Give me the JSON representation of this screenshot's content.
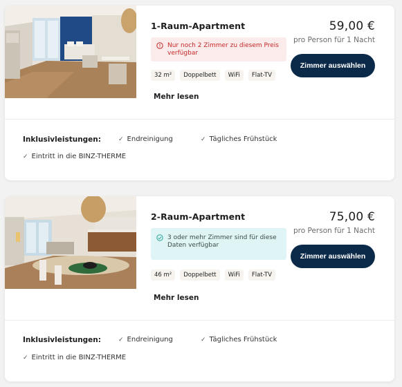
{
  "rooms": [
    {
      "title": "1-Raum-Apartment",
      "notice": "Nur noch 2 Zimmer zu diesem Preis verfügbar",
      "notice_type": "warning",
      "features": [
        "32 m²",
        "Doppelbett",
        "WiFi",
        "Flat-TV"
      ],
      "more_label": "Mehr lesen",
      "price": "59,00 €",
      "price_note": "pro Person für 1 Nacht",
      "select_label": "Zimmer auswählen",
      "inclusions_label": "Inklusivleistungen:",
      "inclusions": [
        "Endreinigung",
        "Tägliches Frühstück",
        "Eintritt in die BINZ-THERME"
      ]
    },
    {
      "title": "2-Raum-Apartment",
      "notice": "3 oder mehr Zimmer sind für diese Daten verfügbar",
      "notice_type": "availability",
      "features": [
        "46 m²",
        "Doppelbett",
        "WiFi",
        "Flat-TV"
      ],
      "more_label": "Mehr lesen",
      "price": "75,00 €",
      "price_note": "pro Person für 1 Nacht",
      "select_label": "Zimmer auswählen",
      "inclusions_label": "Inklusivleistungen:",
      "inclusions": [
        "Endreinigung",
        "Tägliches Frühstück",
        "Eintritt in die BINZ-THERME"
      ]
    }
  ],
  "colors": {
    "button": "#0b2a4a",
    "warning_bg": "#fcebeb",
    "warning_text": "#c62828",
    "availability_bg": "#dff4f4",
    "availability_icon": "#2aa69a"
  },
  "icons": {
    "warning": "alert-circle-icon",
    "availability": "check-circle-icon",
    "inclusion": "check-icon"
  }
}
